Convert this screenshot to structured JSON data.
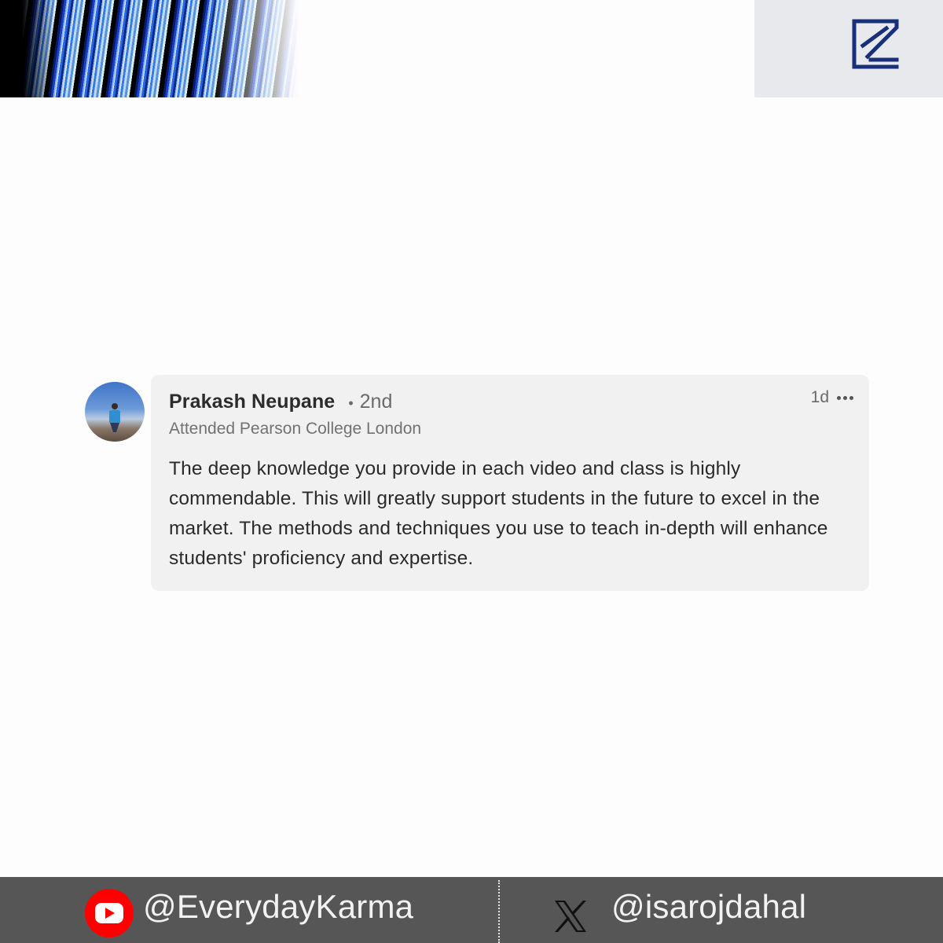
{
  "comment": {
    "author_name": "Prakash Neupane",
    "separator": "•",
    "connection_degree": "2nd",
    "headline": "Attended Pearson College London",
    "time_ago": "1d",
    "more_icon": "more-horizontal-icon",
    "text": "The deep knowledge you provide in each video and class is highly commendable. This will greatly support students in the future to excel in the market. The methods and techniques you use to teach in-depth will enhance students' proficiency and expertise.",
    "avatar": "profile-photo"
  },
  "branding": {
    "logo_icon": "brand-logo-icon",
    "logo_color": "#1a2f7a"
  },
  "footer": {
    "youtube_icon": "youtube-icon",
    "youtube_handle": "@EverydayKarma",
    "x_icon": "x-twitter-icon",
    "x_handle": "@isarojdahal",
    "youtube_color": "#ff0000",
    "background_color": "#565656"
  }
}
